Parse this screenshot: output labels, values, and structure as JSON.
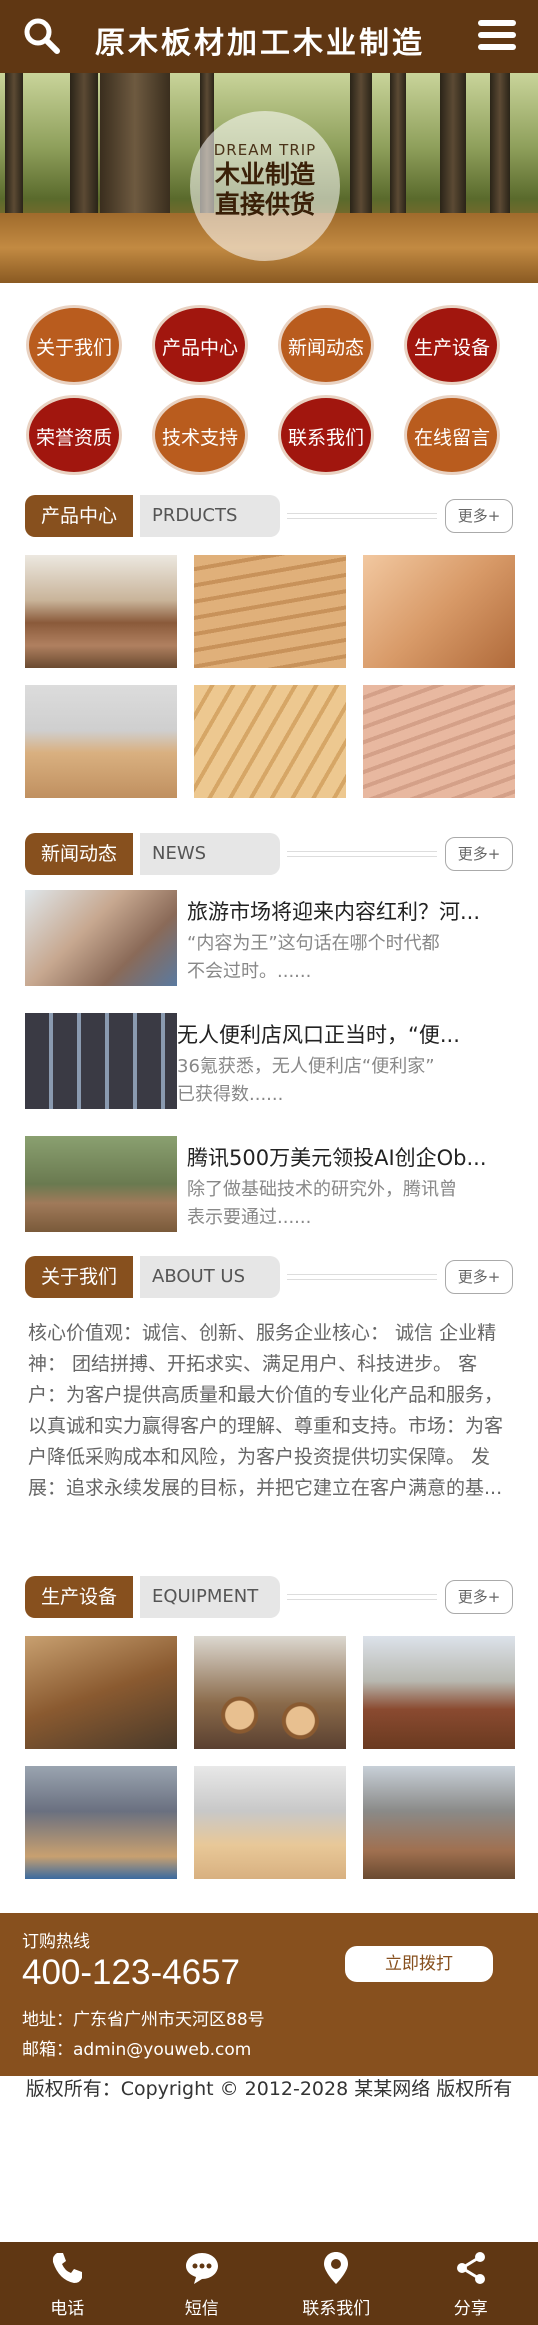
{
  "header": {
    "title": "原木板材加工木业制造",
    "search_icon": "search-icon",
    "menu_icon": "menu-icon"
  },
  "banner": {
    "tag": "DREAM TRIP",
    "line1": "木业制造",
    "line2": "直接供货"
  },
  "nav_circles": [
    {
      "label": "关于我们",
      "color": "#b95c1e"
    },
    {
      "label": "产品中心",
      "color": "#a1160e"
    },
    {
      "label": "新闻动态",
      "color": "#b95c1e"
    },
    {
      "label": "生产设备",
      "color": "#a1160e"
    },
    {
      "label": "荣誉资质",
      "color": "#a1160e"
    },
    {
      "label": "技术支持",
      "color": "#b95c1e"
    },
    {
      "label": "联系我们",
      "color": "#a1160e"
    },
    {
      "label": "在线留言",
      "color": "#b95c1e"
    }
  ],
  "products": {
    "title": "产品中心",
    "subtitle": "PRDUCTS",
    "more": "更多+"
  },
  "news": {
    "title": "新闻动态",
    "subtitle": "NEWS",
    "more": "更多+",
    "items": [
      {
        "title": "旅游市场将迎来内容红利？河...",
        "desc1": "“内容为王”这句话在哪个时代都",
        "desc2": "不会过时。......"
      },
      {
        "title": "无人便利店风口正当时，“便...",
        "desc1": "36氪获悉，无人便利店“便利家”",
        "desc2": "已获得数......"
      },
      {
        "title": "腾讯500万美元领投AI创企Ob...",
        "desc1": "除了做基础技术的研究外，腾讯曾",
        "desc2": "表示要通过......"
      }
    ]
  },
  "about": {
    "title": "关于我们",
    "subtitle": "ABOUT US",
    "more": "更多+",
    "text": "核心价值观：诚信、创新、服务企业核心： 诚信 企业精神： 团结拼搏、开拓求实、满足用户、科技进步。 客户：为客户提供高质量和最大价值的专业化产品和服务，以真诚和实力赢得客户的理解、尊重和支持。市场：为客户降低采购成本和风险，为客户投资提供切实保障。 发展：追求永续发展的目标，并把它建立在客户满意的基..."
  },
  "equipment": {
    "title": "生产设备",
    "subtitle": "EQUIPMENT",
    "more": "更多+"
  },
  "contact": {
    "hotline_label": "订购热线",
    "phone": "400-123-4657",
    "address": "地址：广东省广州市天河区88号",
    "email": "邮箱：admin@youweb.com",
    "call_button": "立即拨打"
  },
  "footer": {
    "copyright": "版权所有：Copyright © 2012-2028 某某网络 版权所有"
  },
  "bottom_nav": [
    {
      "label": "电话",
      "icon": "phone-icon"
    },
    {
      "label": "短信",
      "icon": "sms-icon"
    },
    {
      "label": "联系我们",
      "icon": "location-icon"
    },
    {
      "label": "分享",
      "icon": "share-icon"
    }
  ],
  "colors": {
    "brand": "#603713",
    "section": "#87501e",
    "orange": "#b95c1e",
    "red": "#a1160e"
  }
}
